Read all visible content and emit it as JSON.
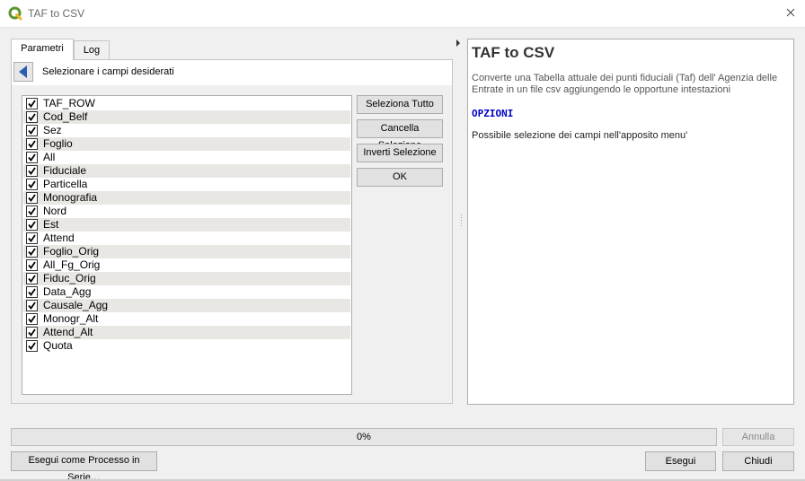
{
  "window": {
    "title": "TAF to CSV",
    "app_icon": "qgis-icon",
    "close_icon": "close-icon"
  },
  "tabs": [
    {
      "label": "Parametri",
      "active": true
    },
    {
      "label": "Log",
      "active": false
    }
  ],
  "panel": {
    "back_icon": "triangle-left-icon",
    "header_label": "Selezionare i campi desiderati"
  },
  "fields": [
    {
      "label": "TAF_ROW",
      "checked": true
    },
    {
      "label": "Cod_Belf",
      "checked": true
    },
    {
      "label": "Sez",
      "checked": true
    },
    {
      "label": "Foglio",
      "checked": true
    },
    {
      "label": "All",
      "checked": true
    },
    {
      "label": "Fiduciale",
      "checked": true
    },
    {
      "label": "Particella",
      "checked": true
    },
    {
      "label": "Monografia",
      "checked": true
    },
    {
      "label": "Nord",
      "checked": true
    },
    {
      "label": "Est",
      "checked": true
    },
    {
      "label": "Attend",
      "checked": true
    },
    {
      "label": "Foglio_Orig",
      "checked": true
    },
    {
      "label": "All_Fg_Orig",
      "checked": true
    },
    {
      "label": "Fiduc_Orig",
      "checked": true
    },
    {
      "label": "Data_Agg",
      "checked": true
    },
    {
      "label": "Causale_Agg",
      "checked": true
    },
    {
      "label": "Monogr_Alt",
      "checked": true
    },
    {
      "label": "Attend_Alt",
      "checked": true
    },
    {
      "label": "Quota",
      "checked": true
    }
  ],
  "actions": {
    "select_all": "Seleziona Tutto",
    "clear_selection": "Cancella Selezione",
    "invert_selection": "Inverti Selezione",
    "ok": "OK"
  },
  "help": {
    "title": "TAF to CSV",
    "description": "Converte una Tabella attuale dei punti fiduciali (Taf) dell' Agenzia delle Entrate in un file csv aggiungendo le opportune intestazioni",
    "options_heading": "OPZIONI",
    "note": "Possibile selezione dei campi nell'apposito menu'"
  },
  "progress": {
    "text": "0%",
    "value": 0
  },
  "footer": {
    "cancel": "Annulla",
    "batch": "Esegui come Processo in Serie…",
    "run": "Esegui",
    "close": "Chiudi"
  },
  "colors": {
    "help_options": "#0000c8",
    "row_alt": "#e9e7e3",
    "qgis_green": "#589632",
    "qgis_yellow": "#f0b323",
    "back_arrow": "#2a5db0"
  }
}
